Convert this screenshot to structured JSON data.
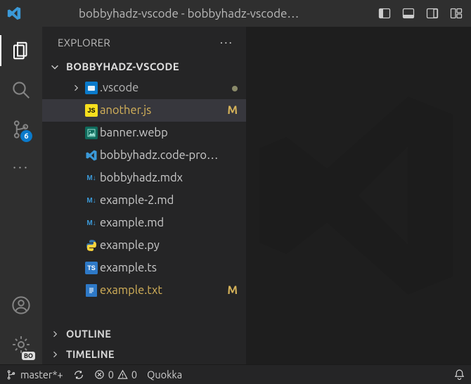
{
  "title": "bobbyhadz-vscode - bobbyhadz-vscode…",
  "sidebar": {
    "header": "EXPLORER",
    "folder": "BOBBYHADZ-VSCODE",
    "items": [
      {
        "name": ".vscode",
        "type": "folder",
        "status": "dot"
      },
      {
        "name": "another.js",
        "type": "js",
        "status": "M",
        "selected": true
      },
      {
        "name": "banner.webp",
        "type": "img"
      },
      {
        "name": "bobbyhadz.code-pro…",
        "type": "vscode"
      },
      {
        "name": "bobbyhadz.mdx",
        "type": "md"
      },
      {
        "name": "example-2.md",
        "type": "md"
      },
      {
        "name": "example.md",
        "type": "md"
      },
      {
        "name": "example.py",
        "type": "py"
      },
      {
        "name": "example.ts",
        "type": "ts"
      },
      {
        "name": "example.txt",
        "type": "txt",
        "status": "M"
      }
    ],
    "outline": "OUTLINE",
    "timeline": "TIMELINE"
  },
  "activity": {
    "scm_badge": "6",
    "settings_badge": "BO"
  },
  "status": {
    "branch": "master*+",
    "sync": "",
    "errors": "0",
    "warnings": "0",
    "quokka": "Quokka"
  }
}
